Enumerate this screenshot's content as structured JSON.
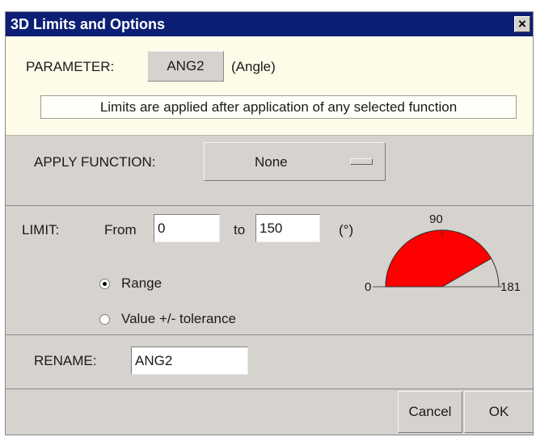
{
  "window": {
    "title": "3D Limits and Options",
    "close_glyph": "×"
  },
  "parameter": {
    "label": "PARAMETER:",
    "value": "ANG2",
    "description": "(Angle)",
    "note": "Limits are applied after application of any selected function"
  },
  "function": {
    "label": "APPLY FUNCTION:",
    "selected": "None"
  },
  "limit": {
    "label": "LIMIT:",
    "from_label": "From",
    "from_value": "0",
    "to_label": "to",
    "to_value": "150",
    "unit": "(°)",
    "mode_options": [
      {
        "label": "Range",
        "checked": true
      },
      {
        "label": "Value +/- tolerance",
        "checked": false
      }
    ],
    "gauge": {
      "tick_labels": {
        "min": "0",
        "mid": "90",
        "max": "181"
      },
      "scale_max": 180,
      "fill_from": 0,
      "fill_to": 150,
      "fill_color": "#ff0000"
    }
  },
  "rename": {
    "label": "RENAME:",
    "value": "ANG2"
  },
  "buttons": {
    "cancel": "Cancel",
    "ok": "OK"
  },
  "colors": {
    "titlebar": "#0c1f74",
    "param_panel": "#fefbe8",
    "dialog_bg": "#d6d3ce"
  }
}
